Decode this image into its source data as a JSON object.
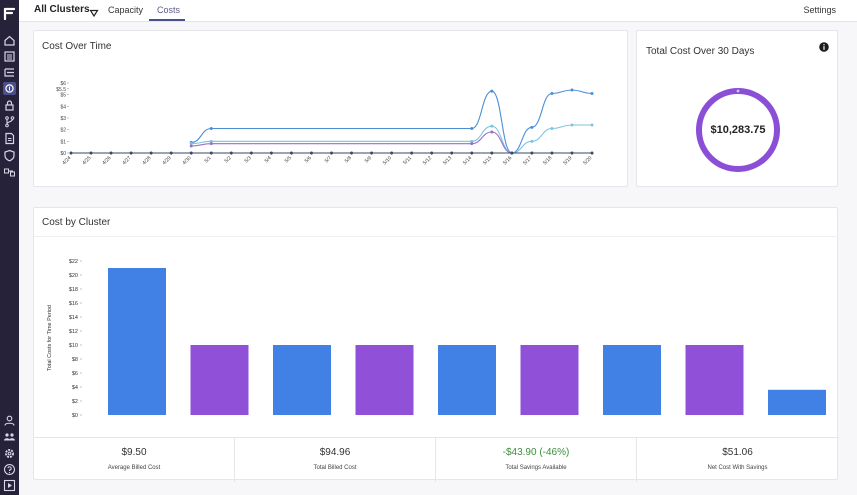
{
  "topbar": {
    "cluster_select": "All Clusters",
    "tabs": [
      {
        "label": "Capacity",
        "active": false
      },
      {
        "label": "Costs",
        "active": true
      }
    ],
    "settings_label": "Settings"
  },
  "sidebar": {
    "logo": "brand-logo",
    "top_icons": [
      "home-icon",
      "list-icon",
      "tree-list-icon",
      "cost-icon",
      "lock-icon",
      "branch-icon",
      "report-icon",
      "shield-icon",
      "integrations-icon"
    ],
    "bottom_icons": [
      "user-icon",
      "team-icon",
      "gear-icon",
      "help-icon",
      "play-icon"
    ]
  },
  "colors": {
    "sidebar": "#26223a",
    "accent": "#4b4f8c",
    "ring": "#8a4fd6",
    "bar_blue": "#4180e5",
    "bar_purple": "#9150d8",
    "savings_green": "#3c8f3c"
  },
  "cost_over_time": {
    "title": "Cost Over Time"
  },
  "total_cost": {
    "title": "Total Cost Over 30 Days",
    "amount": "$10,283.75"
  },
  "cost_by_cluster": {
    "title": "Cost by Cluster"
  },
  "stats": [
    {
      "value": "$9.50",
      "label": "Average Billed Cost"
    },
    {
      "value": "$94.96",
      "label": "Total Billed Cost"
    },
    {
      "value": "-$43.90 (-46%)",
      "label": "Total Savings Available"
    },
    {
      "value": "$51.06",
      "label": "Net Cost With Savings"
    }
  ],
  "chart_data": [
    {
      "type": "line",
      "title": "Cost Over Time",
      "x": [
        "4/24",
        "4/25",
        "4/26",
        "4/27",
        "4/28",
        "4/29",
        "4/30",
        "5/1",
        "5/2",
        "5/3",
        "5/4",
        "5/5",
        "5/6",
        "5/7",
        "5/8",
        "5/9",
        "5/10",
        "5/11",
        "5/12",
        "5/13",
        "5/14",
        "5/15",
        "5/16",
        "5/17",
        "5/18",
        "5/19",
        "5/20"
      ],
      "y_ticks": [
        "$0",
        "$1",
        "$2",
        "$3",
        "$4",
        "$5",
        "$5.5",
        "$6"
      ],
      "ylim": [
        0,
        6
      ],
      "series": [
        {
          "color": "#4a8fd6",
          "values": [
            null,
            null,
            null,
            null,
            null,
            null,
            0.9,
            2.1,
            2.1,
            2.1,
            2.1,
            2.1,
            2.1,
            2.1,
            2.1,
            2.1,
            2.1,
            2.1,
            2.1,
            2.1,
            2.1,
            5.3,
            0,
            2.2,
            5.1,
            5.4,
            5.1
          ]
        },
        {
          "color": "#7ec3df",
          "values": [
            null,
            null,
            null,
            null,
            null,
            null,
            0.8,
            1.0,
            1.0,
            1.0,
            1.0,
            1.0,
            1.0,
            1.0,
            1.0,
            1.0,
            1.0,
            1.0,
            1.0,
            1.0,
            1.0,
            2.3,
            0,
            1.0,
            2.1,
            2.4,
            2.4
          ]
        },
        {
          "color": "#9b6fc9",
          "values": [
            null,
            null,
            null,
            null,
            null,
            null,
            0.6,
            0.8,
            0.8,
            0.8,
            0.8,
            0.8,
            0.8,
            0.8,
            0.8,
            0.8,
            0.8,
            0.8,
            0.8,
            0.8,
            0.8,
            1.8,
            0,
            null,
            null,
            null,
            null
          ]
        },
        {
          "color": "#3a4a66",
          "values": [
            0,
            0,
            0,
            0,
            0,
            0,
            0,
            0,
            0,
            0,
            0,
            0,
            0,
            0,
            0,
            0,
            0,
            0,
            0,
            0,
            0,
            0,
            0,
            0,
            0,
            0,
            0
          ]
        }
      ]
    },
    {
      "type": "bar",
      "title": "Cost by Cluster",
      "ylabel": "Total Costs for Time Period",
      "y_ticks": [
        "$0",
        "$2",
        "$4",
        "$6",
        "$8",
        "$10",
        "$12",
        "$14",
        "$16",
        "$18",
        "$20",
        "$22"
      ],
      "ylim": [
        0,
        22
      ],
      "categories": [
        "",
        "",
        "",
        "",
        "",
        "",
        "",
        "",
        ""
      ],
      "values": [
        21,
        10,
        10,
        10,
        10,
        10,
        10,
        10,
        3.6
      ],
      "bar_colors": [
        "#4180e5",
        "#9150d8",
        "#4180e5",
        "#9150d8",
        "#4180e5",
        "#9150d8",
        "#4180e5",
        "#9150d8",
        "#4180e5"
      ]
    }
  ]
}
